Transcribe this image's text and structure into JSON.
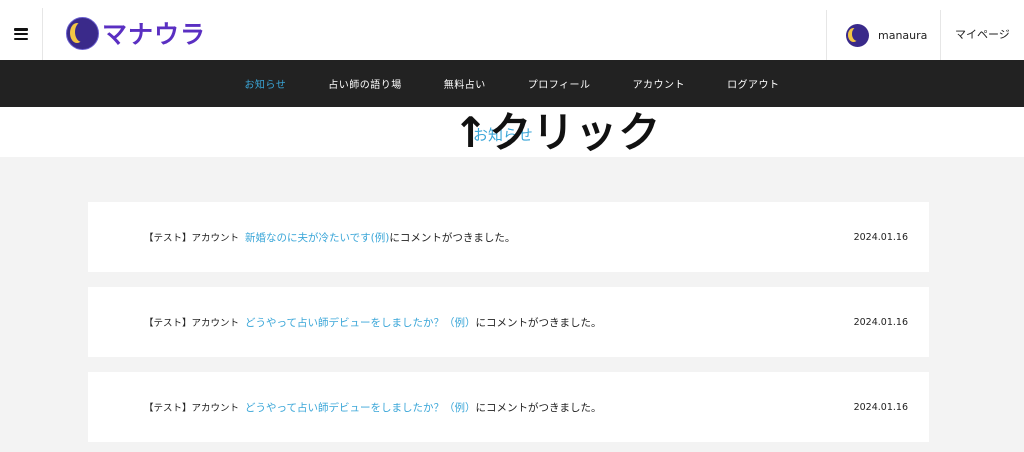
{
  "header": {
    "logo_text": "マナウラ",
    "username": "manaura",
    "mypage_label": "マイページ"
  },
  "nav": {
    "items": [
      {
        "label": "お知らせ"
      },
      {
        "label": "占い師の語り場"
      },
      {
        "label": "無料占い"
      },
      {
        "label": "プロフィール"
      },
      {
        "label": "アカウント"
      },
      {
        "label": "ログアウト"
      }
    ],
    "active_index": 0
  },
  "page": {
    "title": "お知らせ",
    "annotation": "↑クリック"
  },
  "notices": [
    {
      "label": "【テスト】アカウント",
      "link": "新婚なのに夫が冷たいです(例)",
      "suffix": "にコメントがつきました。",
      "date": "2024.01.16"
    },
    {
      "label": "【テスト】アカウント",
      "link": "どうやって占い師デビューをしましたか？（例）",
      "suffix": "にコメントがつきました。",
      "date": "2024.01.16"
    },
    {
      "label": "【テスト】アカウント",
      "link": "どうやって占い師デビューをしましたか？（例）",
      "suffix": "にコメントがつきました。",
      "date": "2024.01.16"
    }
  ],
  "colors": {
    "accent": "#3aa6d8",
    "nav_bg": "#222222",
    "logo": "#5a2fc2"
  }
}
